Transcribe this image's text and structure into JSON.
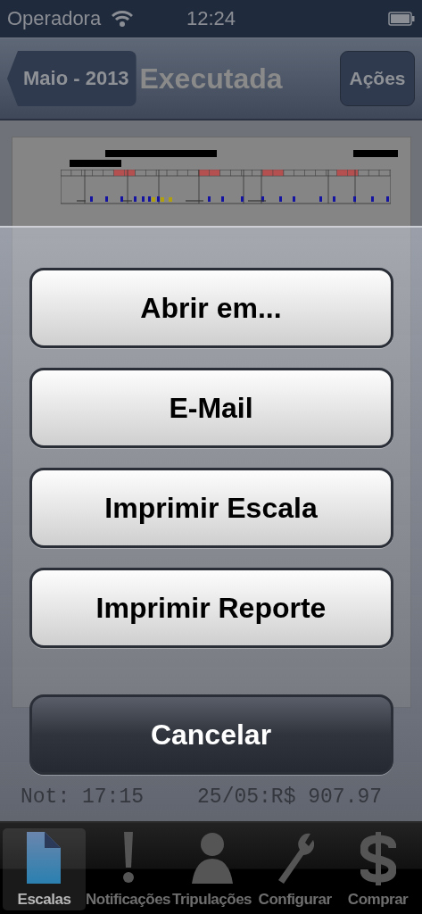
{
  "status_bar": {
    "carrier": "Operadora",
    "time": "12:24"
  },
  "nav_bar": {
    "back": "Maio - 2013",
    "title": "Executada",
    "action": "Ações"
  },
  "document": {
    "footer": [
      {
        "text": "Not: 17:15"
      },
      {
        "text": "25/05:R$  907.97"
      }
    ]
  },
  "action_sheet": {
    "buttons": [
      {
        "label": "Abrir em...",
        "kind": "default"
      },
      {
        "label": "E-Mail",
        "kind": "default"
      },
      {
        "label": "Imprimir Escala",
        "kind": "default"
      },
      {
        "label": "Imprimir Reporte",
        "kind": "default"
      },
      {
        "label": "Cancelar",
        "kind": "cancel"
      }
    ]
  },
  "tab_bar": {
    "items": [
      {
        "label": "Escalas",
        "selected": true
      },
      {
        "label": "Notificações",
        "selected": false
      },
      {
        "label": "Tripulações",
        "selected": false
      },
      {
        "label": "Configurar",
        "selected": false
      },
      {
        "label": "Comprar",
        "selected": false
      }
    ]
  }
}
